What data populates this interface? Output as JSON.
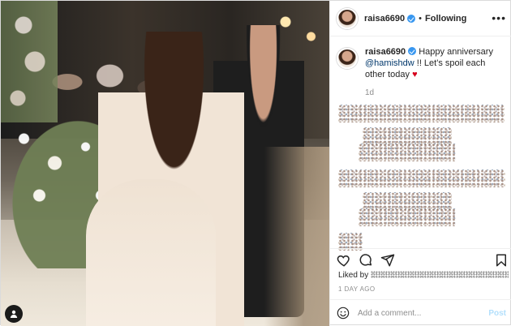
{
  "post": {
    "username": "raisa6690",
    "follow_separator": "•",
    "follow_status": "Following",
    "more_label": "•••",
    "caption": {
      "username": "raisa6690",
      "text_before": "Happy anniversary ",
      "mention": "@hamishdw",
      "text_after": " !! Let's spoil each other today ",
      "emoji": "♥",
      "time": "1d"
    },
    "liked_by_prefix": "Liked by ",
    "posted_time": "1 DAY AGO",
    "comment": {
      "placeholder": "Add a comment...",
      "post_label": "Post"
    }
  },
  "colors": {
    "verified": "#3897f0",
    "mention": "#00376b",
    "heart": "#d6001c",
    "post_button_disabled": "#b2dffc"
  },
  "icons": [
    "tag-user-icon",
    "more-options-icon",
    "verified-badge-icon",
    "heart-icon",
    "comment-icon",
    "share-icon",
    "bookmark-icon",
    "emoji-icon"
  ]
}
